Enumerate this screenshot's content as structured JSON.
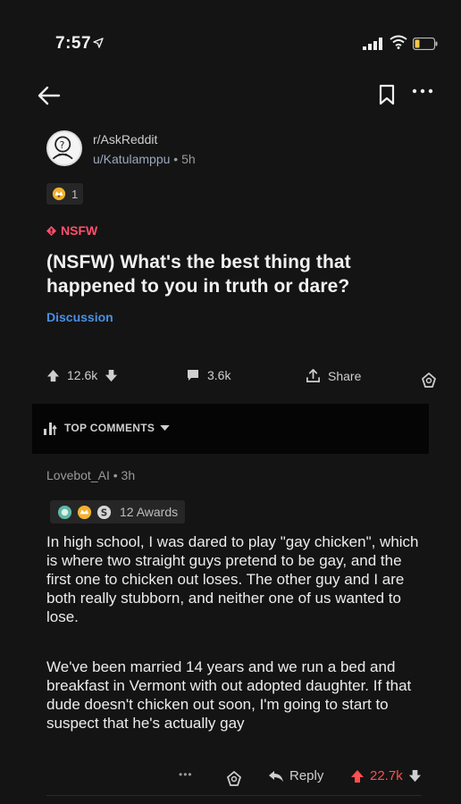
{
  "status": {
    "time": "7:57"
  },
  "post": {
    "subreddit": "r/AskReddit",
    "author": "u/Katulamppu",
    "separator": "•",
    "age": "5h",
    "award_count": "1",
    "nsfw_label": "NSFW",
    "title": "(NSFW) What's the best thing that happened to you in truth or dare?",
    "flair": "Discussion",
    "upvotes": "12.6k",
    "comments": "3.6k",
    "share_label": "Share"
  },
  "sort": {
    "label": "TOP COMMENTS"
  },
  "comment": {
    "author": "Lovebot_AI",
    "separator": "•",
    "age": "3h",
    "awards_label": "12 Awards",
    "paragraph1": "In high school, I was dared to play \"gay chicken\", which is where two straight guys pretend to be gay, and the first one to chicken out loses. The other guy and I are both really stubborn, and neither one of us wanted to lose.",
    "paragraph2": "We've been married 14 years and we run a bed and breakfast in Vermont with out adopted daughter. If that dude doesn't chicken out soon, I'm going to start to suspect that he's actually gay",
    "more_label": "•••",
    "reply_label": "Reply",
    "score": "22.7k"
  },
  "colors": {
    "background": "#141414",
    "nsfw": "#ff4f6d",
    "flair": "#4a90e2",
    "upvoted": "#ff4f4f",
    "username": "#9aa8bd"
  },
  "icons": [
    "location-arrow-icon",
    "signal-icon",
    "wifi-icon",
    "battery-icon",
    "back-arrow-icon",
    "bookmark-icon",
    "more-icon",
    "avatar-icon",
    "award-icon",
    "nsfw-icon",
    "upvote-icon",
    "downvote-icon",
    "comment-icon",
    "share-icon",
    "award-outline-icon",
    "sort-icon",
    "chevron-down-icon",
    "reply-icon"
  ]
}
